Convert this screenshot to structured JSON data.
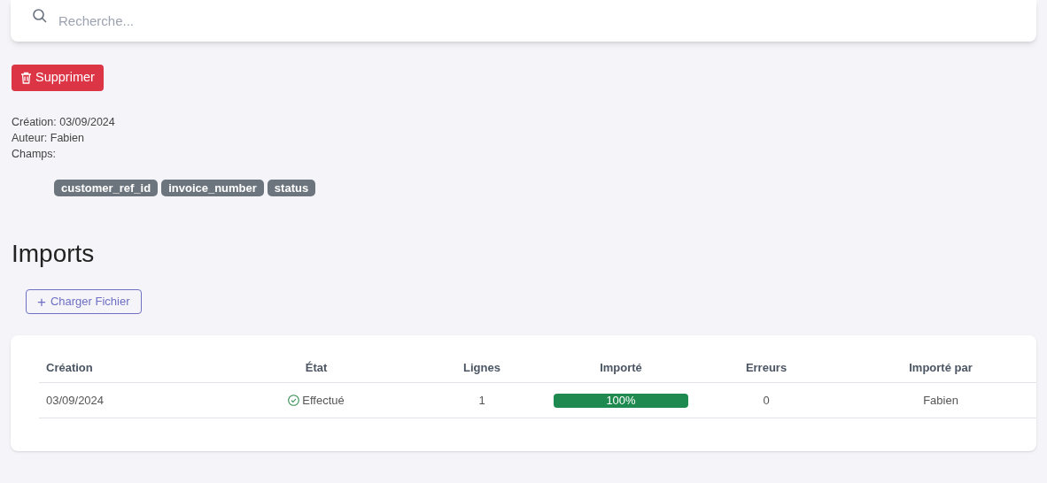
{
  "search": {
    "placeholder": "Recherche..."
  },
  "delete_button": {
    "label": "Supprimer"
  },
  "meta": [
    "Création: 03/09/2024",
    "Auteur: Fabien",
    "Champs:"
  ],
  "fields": [
    "customer_ref_id",
    "invoice_number",
    "status"
  ],
  "imports": {
    "title": "Imports",
    "upload_button": {
      "icon": "+",
      "label": "Charger Fichier"
    },
    "table": {
      "columns": [
        "Création",
        "État",
        "Lignes",
        "Importé",
        "Erreurs",
        "Importé par"
      ],
      "rows": [
        {
          "creation": "03/09/2024",
          "state": "Effectué",
          "done": true,
          "lines": "1",
          "imported": {
            "level": 1,
            "reading": "100%"
          },
          "errors": "0",
          "by": "Fabien"
        }
      ]
    }
  }
}
